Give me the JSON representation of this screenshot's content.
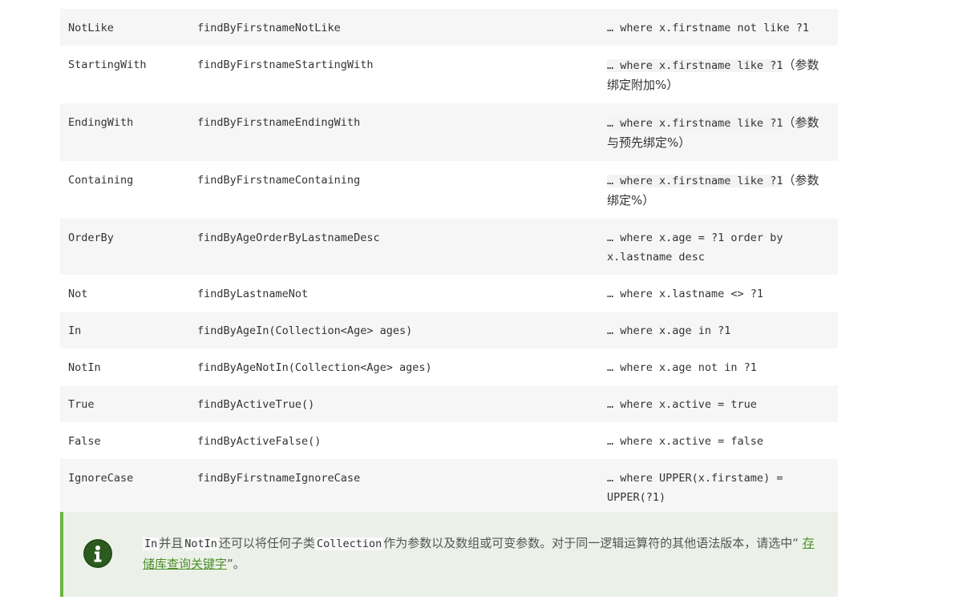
{
  "keyword_table": {
    "rows": [
      {
        "keyword": "NotLike",
        "sample": "findByFirstnameNotLike",
        "jpql": "… where x.firstname not like ?1",
        "note": ""
      },
      {
        "keyword": "StartingWith",
        "sample": "findByFirstnameStartingWith",
        "jpql": "… where x.firstname like ?1",
        "note": "（参数绑定附加%）"
      },
      {
        "keyword": "EndingWith",
        "sample": "findByFirstnameEndingWith",
        "jpql": "… where x.firstname like ?1",
        "note": "（参数与预先绑定%）"
      },
      {
        "keyword": "Containing",
        "sample": "findByFirstnameContaining",
        "jpql": "… where x.firstname like ?1",
        "note": "（参数绑定%）"
      },
      {
        "keyword": "OrderBy",
        "sample": "findByAgeOrderByLastnameDesc",
        "jpql": "… where x.age = ?1 order by x.lastname desc",
        "note": ""
      },
      {
        "keyword": "Not",
        "sample": "findByLastnameNot",
        "jpql": "… where x.lastname <> ?1",
        "note": ""
      },
      {
        "keyword": "In",
        "sample": "findByAgeIn(Collection<Age> ages)",
        "jpql": "… where x.age in ?1",
        "note": ""
      },
      {
        "keyword": "NotIn",
        "sample": "findByAgeNotIn(Collection<Age> ages)",
        "jpql": "… where x.age not in ?1",
        "note": ""
      },
      {
        "keyword": "True",
        "sample": "findByActiveTrue()",
        "jpql": "… where x.active = true",
        "note": ""
      },
      {
        "keyword": "False",
        "sample": "findByActiveFalse()",
        "jpql": "… where x.active = false",
        "note": ""
      },
      {
        "keyword": "IgnoreCase",
        "sample": "findByFirstnameIgnoreCase",
        "jpql": "… where UPPER(x.firstame) = UPPER(?1)",
        "note": ""
      }
    ]
  },
  "tip": {
    "icon": "info-icon",
    "code_in": "In",
    "text_and": "并且",
    "code_notin": "NotIn",
    "text_mid": "还可以将任何子类",
    "code_collection": "Collection",
    "text_rest": "作为参数以及数组或可变参数。对于同一逻辑运算符的其他语法版本，请选中“",
    "link_label": "存储库查询关键字",
    "text_end": "”。"
  },
  "colors": {
    "row_stripe": "#f6f6f6",
    "tip_background": "#ebf1e8",
    "tip_border": "#6db33f",
    "icon_fill": "#2d5b1f",
    "link": "#4d8f2a"
  }
}
